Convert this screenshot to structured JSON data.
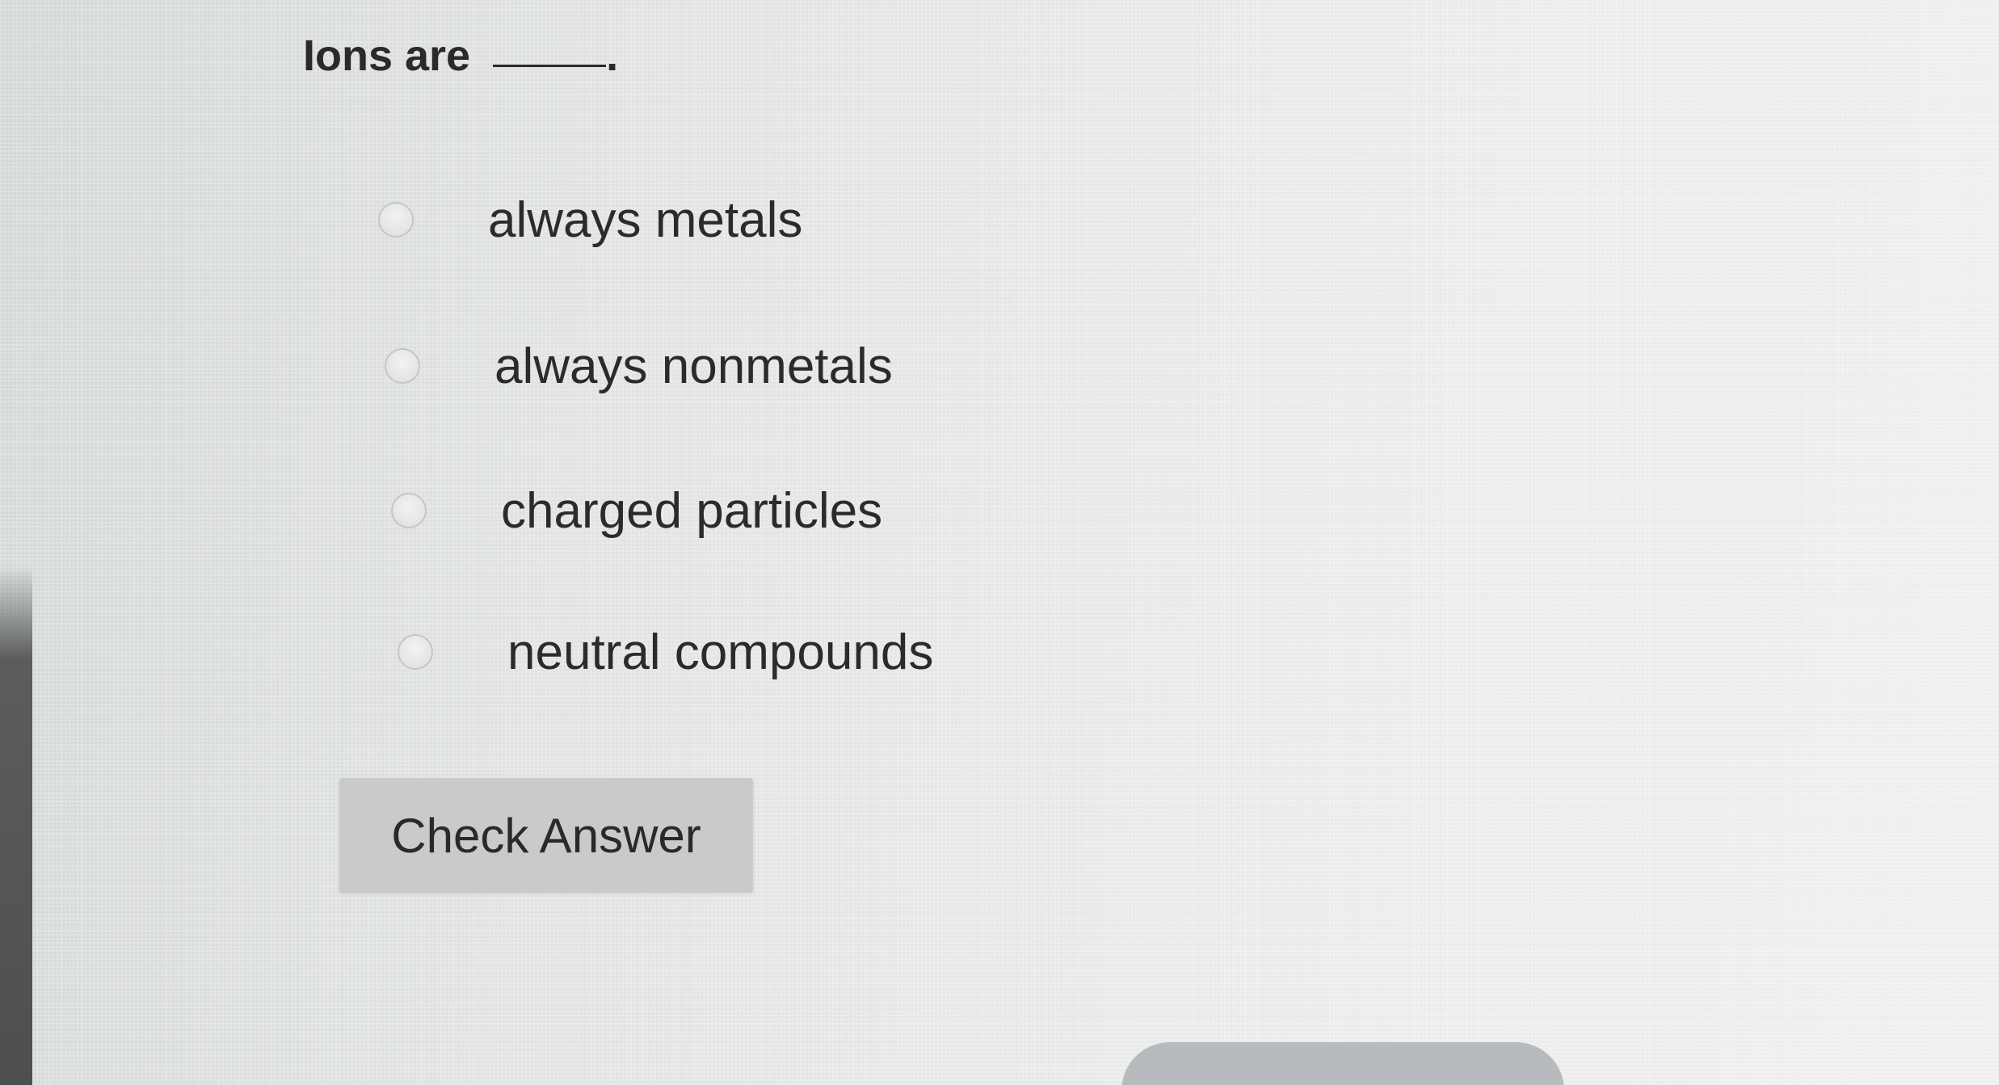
{
  "question": {
    "text": "Ions are",
    "after_blank": "."
  },
  "options": [
    {
      "label": "always metals",
      "selected": false
    },
    {
      "label": "always nonmetals",
      "selected": false
    },
    {
      "label": "charged particles",
      "selected": false
    },
    {
      "label": "neutral compounds",
      "selected": false
    }
  ],
  "actions": {
    "check_answer_label": "Check Answer"
  }
}
